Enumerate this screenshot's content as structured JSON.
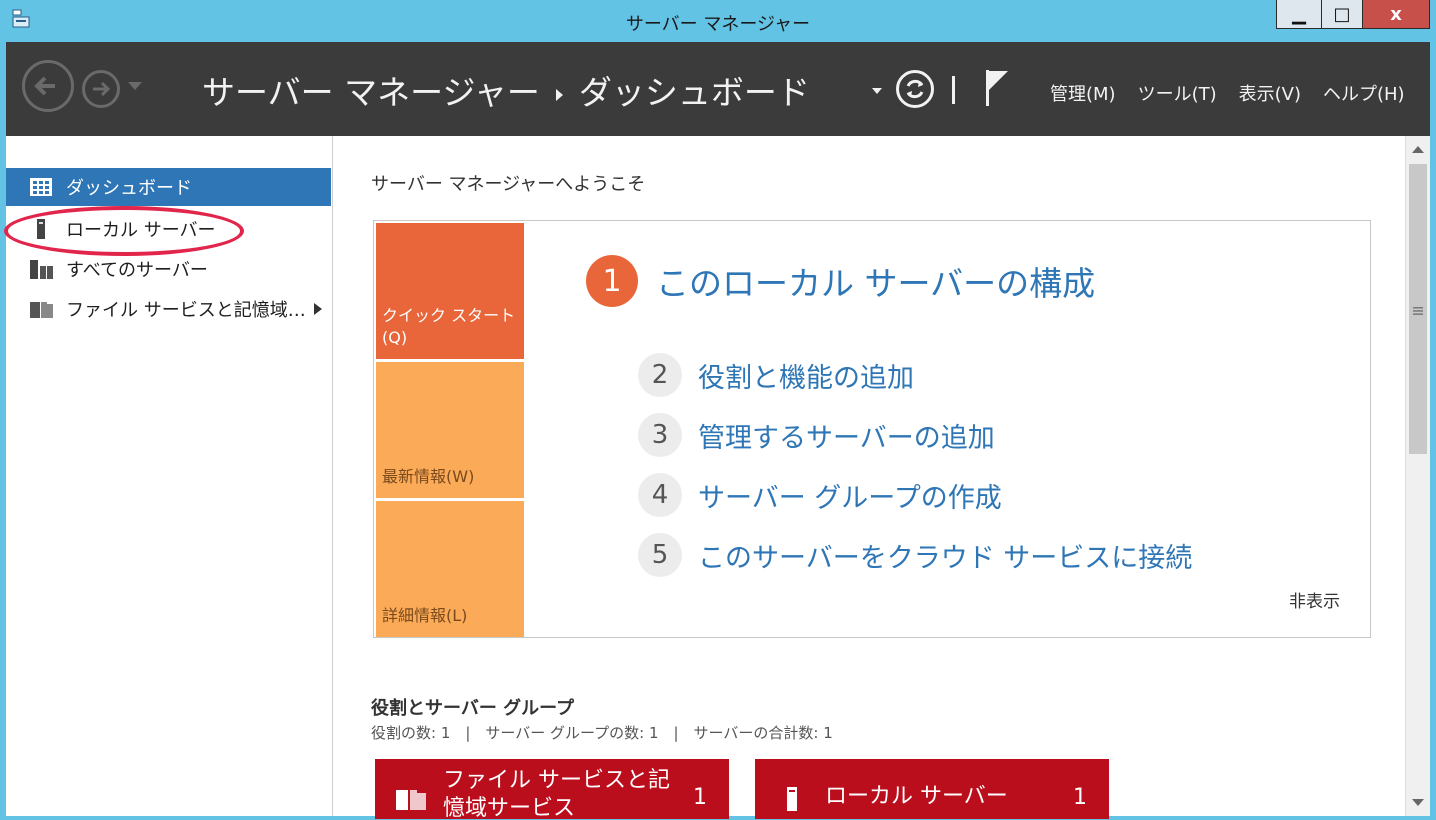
{
  "window": {
    "title": "サーバー マネージャー",
    "minimize_label": "▁",
    "maximize_label": "□",
    "close_label": "x"
  },
  "header": {
    "breadcrumb_root": "サーバー マネージャー",
    "breadcrumb_current": "ダッシュボード",
    "menus": [
      "管理(M)",
      "ツール(T)",
      "表示(V)",
      "ヘルプ(H)"
    ]
  },
  "sidebar": {
    "items": [
      {
        "label": "ダッシュボード",
        "icon": "dashboard-grid-icon",
        "active": true
      },
      {
        "label": "ローカル サーバー",
        "icon": "server-icon",
        "active": false
      },
      {
        "label": "すべてのサーバー",
        "icon": "servers-icon",
        "active": false
      },
      {
        "label": "ファイル サービスと記憶域…",
        "icon": "file-services-icon",
        "active": false
      }
    ]
  },
  "main": {
    "welcome_title": "サーバー マネージャーへようこそ",
    "tiles": {
      "quick_start": "クイック スタート (Q)",
      "whats_new": "最新情報(W)",
      "learn_more": "詳細情報(L)"
    },
    "steps": [
      {
        "num": "1",
        "label": "このローカル サーバーの構成"
      },
      {
        "num": "2",
        "label": "役割と機能の追加"
      },
      {
        "num": "3",
        "label": "管理するサーバーの追加"
      },
      {
        "num": "4",
        "label": "サーバー グループの作成"
      },
      {
        "num": "5",
        "label": "このサーバーをクラウド サービスに接続"
      }
    ],
    "hide_label": "非表示",
    "roles_title": "役割とサーバー グループ",
    "roles_counts": "役割の数: 1　|　サーバー グループの数: 1　|　サーバーの合計数: 1",
    "cards": [
      {
        "name": "ファイル サービスと記憶域サービス",
        "count": "1"
      },
      {
        "name": "ローカル サーバー",
        "count": "1"
      }
    ]
  },
  "colors": {
    "title_bar": "#62c3e4",
    "header_bg": "#3b3b3b",
    "sidebar_active": "#2e76b5",
    "quick_start_tile": "#e9663a",
    "tile_light": "#fbaa57",
    "link_blue": "#2e76b5",
    "card_red": "#bb0e1d",
    "annotation_ellipse": "#e2264b"
  }
}
